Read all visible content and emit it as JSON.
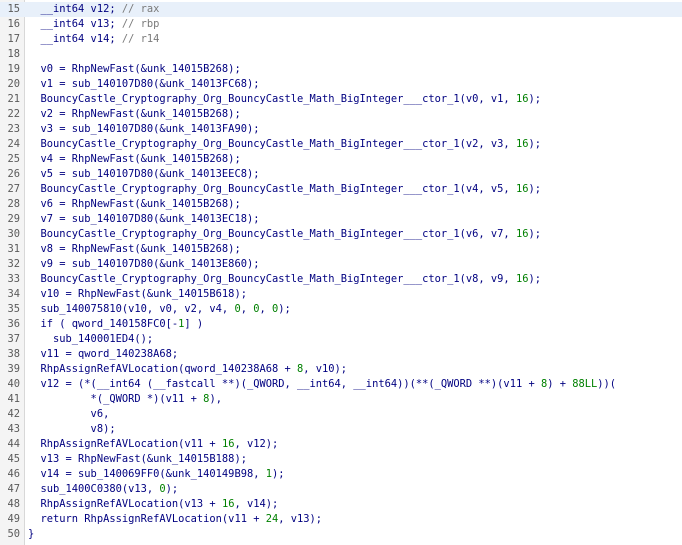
{
  "editor": {
    "lines": [
      {
        "num": "15",
        "text": "  __int64 v12; // rax",
        "highlight": true
      },
      {
        "num": "16",
        "text": "  __int64 v13; // rbp"
      },
      {
        "num": "17",
        "text": "  __int64 v14; // r14"
      },
      {
        "num": "18",
        "text": ""
      },
      {
        "num": "19",
        "text": "  v0 = RhpNewFast(&unk_14015B268);"
      },
      {
        "num": "20",
        "text": "  v1 = sub_140107D80(&unk_14013FC68);"
      },
      {
        "num": "21",
        "text": "  BouncyCastle_Cryptography_Org_BouncyCastle_Math_BigInteger___ctor_1(v0, v1, 16);"
      },
      {
        "num": "22",
        "text": "  v2 = RhpNewFast(&unk_14015B268);"
      },
      {
        "num": "23",
        "text": "  v3 = sub_140107D80(&unk_14013FA90);"
      },
      {
        "num": "24",
        "text": "  BouncyCastle_Cryptography_Org_BouncyCastle_Math_BigInteger___ctor_1(v2, v3, 16);"
      },
      {
        "num": "25",
        "text": "  v4 = RhpNewFast(&unk_14015B268);"
      },
      {
        "num": "26",
        "text": "  v5 = sub_140107D80(&unk_14013EEC8);"
      },
      {
        "num": "27",
        "text": "  BouncyCastle_Cryptography_Org_BouncyCastle_Math_BigInteger___ctor_1(v4, v5, 16);"
      },
      {
        "num": "28",
        "text": "  v6 = RhpNewFast(&unk_14015B268);"
      },
      {
        "num": "29",
        "text": "  v7 = sub_140107D80(&unk_14013EC18);"
      },
      {
        "num": "30",
        "text": "  BouncyCastle_Cryptography_Org_BouncyCastle_Math_BigInteger___ctor_1(v6, v7, 16);"
      },
      {
        "num": "31",
        "text": "  v8 = RhpNewFast(&unk_14015B268);"
      },
      {
        "num": "32",
        "text": "  v9 = sub_140107D80(&unk_14013E860);"
      },
      {
        "num": "33",
        "text": "  BouncyCastle_Cryptography_Org_BouncyCastle_Math_BigInteger___ctor_1(v8, v9, 16);"
      },
      {
        "num": "34",
        "text": "  v10 = RhpNewFast(&unk_14015B618);"
      },
      {
        "num": "35",
        "text": "  sub_140075810(v10, v0, v2, v4, 0, 0, 0);"
      },
      {
        "num": "36",
        "text": "  if ( qword_140158FC0[-1] )"
      },
      {
        "num": "37",
        "text": "    sub_140001ED4();"
      },
      {
        "num": "38",
        "text": "  v11 = qword_140238A68;"
      },
      {
        "num": "39",
        "text": "  RhpAssignRefAVLocation(qword_140238A68 + 8, v10);"
      },
      {
        "num": "40",
        "text": "  v12 = (*(__int64 (__fastcall **)(_QWORD, __int64, __int64))(**(_QWORD **)(v11 + 8) + 88LL))("
      },
      {
        "num": "41",
        "text": "          *(_QWORD *)(v11 + 8),"
      },
      {
        "num": "42",
        "text": "          v6,"
      },
      {
        "num": "43",
        "text": "          v8);"
      },
      {
        "num": "44",
        "text": "  RhpAssignRefAVLocation(v11 + 16, v12);"
      },
      {
        "num": "45",
        "text": "  v13 = RhpNewFast(&unk_14015B188);"
      },
      {
        "num": "46",
        "text": "  v14 = sub_140069FF0(&unk_140149B98, 1);"
      },
      {
        "num": "47",
        "text": "  sub_1400C0380(v13, 0);"
      },
      {
        "num": "48",
        "text": "  RhpAssignRefAVLocation(v13 + 16, v14);"
      },
      {
        "num": "49",
        "text": "  return RhpAssignRefAVLocation(v11 + 24, v13);"
      },
      {
        "num": "50",
        "text": "}"
      }
    ]
  }
}
